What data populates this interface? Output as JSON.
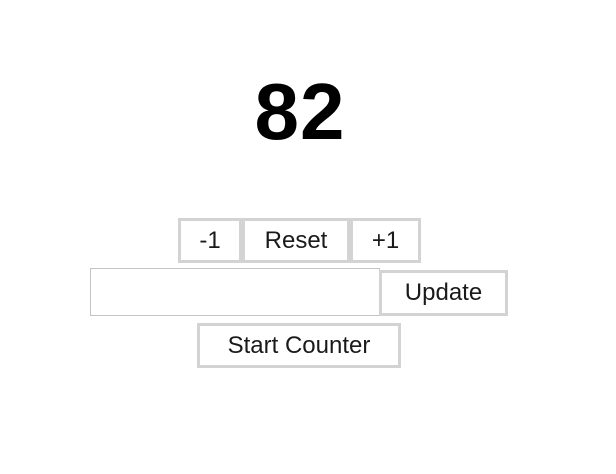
{
  "counter": {
    "value": "82"
  },
  "controls": {
    "decrement_label": "-1",
    "reset_label": "Reset",
    "increment_label": "+1"
  },
  "update_form": {
    "input_value": "",
    "input_placeholder": "",
    "update_label": "Update"
  },
  "start_label": "Start Counter"
}
